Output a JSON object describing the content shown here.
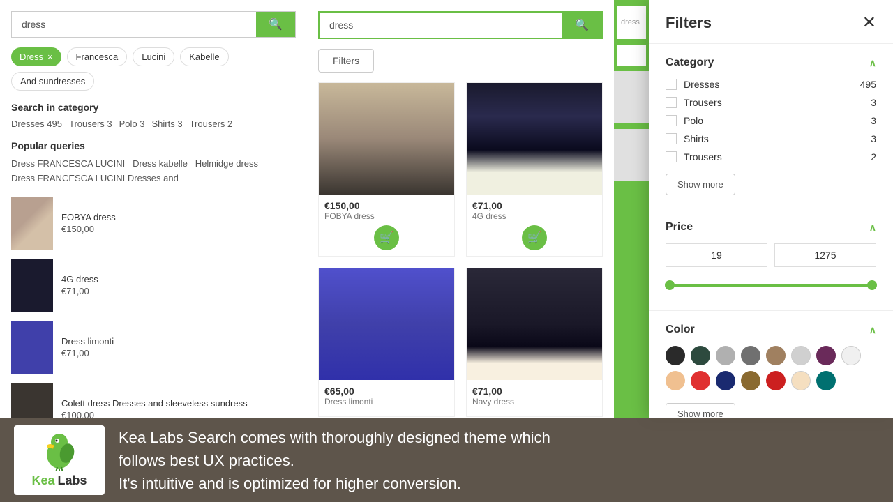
{
  "left": {
    "search": {
      "value": "dress",
      "placeholder": "dress"
    },
    "tags": [
      "Dress",
      "Francesca",
      "Lucini",
      "Kabelle",
      "And sundresses"
    ],
    "search_in_category_title": "Search in category",
    "categories": [
      {
        "name": "Dresses",
        "count": 495
      },
      {
        "name": "Trousers",
        "count": 3
      },
      {
        "name": "Polo",
        "count": 3
      },
      {
        "name": "Shirts",
        "count": 3
      },
      {
        "name": "Trousers",
        "count": 2
      }
    ],
    "popular_title": "Popular queries",
    "popular_queries": [
      "Dress FRANCESCA LUCINI",
      "Dress kabelle",
      "Helmidge dress",
      "Dress FRANCESCA LUCINI Dresses and"
    ],
    "products": [
      {
        "name": "FOBYA dress",
        "price": "€150,00"
      },
      {
        "name": "4G dress",
        "price": "€71,00"
      },
      {
        "name": "Dress limonti",
        "price": "€71,00"
      },
      {
        "name": "Colett dress Dresses and sleeveless sundress",
        "price": "€100,00"
      }
    ]
  },
  "middle": {
    "search": {
      "value": "dress",
      "placeholder": "dress"
    },
    "filters_btn": "Filters",
    "products": [
      {
        "price": "€150,00",
        "name": "FOBYA dress"
      },
      {
        "price": "€71,00",
        "name": "4G dress"
      },
      {
        "price": "€65,00",
        "name": "Dress limonti"
      },
      {
        "price": "€71,00",
        "name": "Navy dress"
      }
    ],
    "cart_icon": "🛒"
  },
  "filters": {
    "title": "Filters",
    "close_icon": "✕",
    "category": {
      "label": "Category",
      "items": [
        {
          "name": "Dresses",
          "count": 495
        },
        {
          "name": "Trousers",
          "count": 3
        },
        {
          "name": "Polo",
          "count": 3
        },
        {
          "name": "Shirts",
          "count": 3
        },
        {
          "name": "Trousers",
          "count": 2
        }
      ],
      "show_more": "Show more"
    },
    "price": {
      "label": "Price",
      "min": "19",
      "max": "1275",
      "min_pos": 2,
      "max_pos": 98
    },
    "color": {
      "label": "Color",
      "swatches": [
        "#2a2a2a",
        "#2d4a3e",
        "#b0b0b0",
        "#707070",
        "#a08060",
        "#d0d0d0",
        "#6a2a5a",
        "#f0f0f0",
        "#f0c090",
        "#e03030",
        "#1a2a70",
        "#8a6a30",
        "#cc2020",
        "#f5dfc0",
        "#007070"
      ],
      "show_more": "Show more"
    }
  },
  "banner": {
    "logo_kea": "Kea",
    "logo_labs": "Labs",
    "text_line1": "Kea Labs Search comes with thoroughly designed theme which",
    "text_line2": "follows best UX practices.",
    "text_line3": "It's intuitive and is optimized for higher conversion."
  },
  "icons": {
    "search": "🔍",
    "cart": "🛒",
    "close": "✕",
    "chevron_up": "∧",
    "tag_close": "×"
  }
}
